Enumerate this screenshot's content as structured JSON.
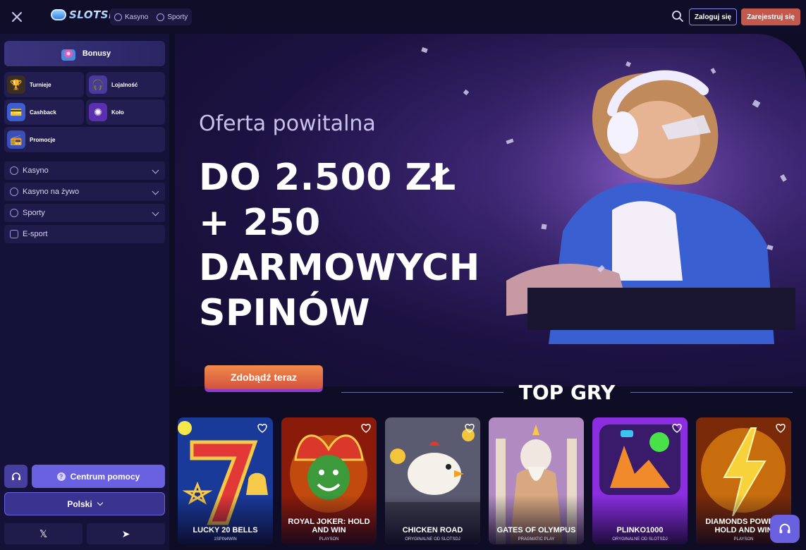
{
  "header": {
    "logo_text": "SLOTSDJ",
    "nav": [
      {
        "label": "Kasyno",
        "icon": "casino-icon"
      },
      {
        "label": "Sporty",
        "icon": "sports-icon"
      }
    ],
    "login_label": "Zaloguj się",
    "register_label": "Zarejestruj się"
  },
  "sidebar": {
    "bonus_label": "Bonusy",
    "tiles": [
      {
        "label": "Turnieje",
        "icon": "trophy-icon"
      },
      {
        "label": "Lojalność",
        "icon": "loyalty-icon"
      },
      {
        "label": "Cashback",
        "icon": "cashback-icon"
      },
      {
        "label": "Koło",
        "icon": "wheel-icon"
      },
      {
        "label": "Promocje",
        "icon": "promo-icon"
      }
    ],
    "menu": [
      {
        "label": "Kasyno",
        "icon": "casino-icon"
      },
      {
        "label": "Kasyno na żywo",
        "icon": "live-casino-icon"
      },
      {
        "label": "Sporty",
        "icon": "sports-icon"
      },
      {
        "label": "E-sport",
        "icon": "esport-icon"
      }
    ],
    "help_label": "Centrum pomocy",
    "language_label": "Polski",
    "social": [
      {
        "label": "𝕏",
        "icon": "x-icon"
      },
      {
        "label": "➤",
        "icon": "telegram-icon"
      }
    ]
  },
  "hero": {
    "subtitle": "Oferta powitalna",
    "title_lines": [
      "DO 2.500 ZŁ",
      "+ 250",
      "DARMOWYCH",
      "SPINÓW"
    ],
    "cta_label": "Zdobądź teraz"
  },
  "top_games": {
    "title": "TOP GRY",
    "games": [
      {
        "name": "LUCKY 20 BELLS",
        "provider": "1SPIN4WIN"
      },
      {
        "name": "ROYAL JOKER: HOLD AND WIN",
        "provider": "PLAYSON"
      },
      {
        "name": "CHICKEN ROAD",
        "provider": "ORYGINALNE OD SLOTSDJ"
      },
      {
        "name": "GATES OF OLYMPUS",
        "provider": "PRAGMATIC PLAY"
      },
      {
        "name": "PLINKO1000",
        "provider": "ORYGINALNE OD SLOTSDJ"
      },
      {
        "name": "DIAMONDS POWER: HOLD AND WIN",
        "provider": "PLAYSON"
      }
    ]
  },
  "colors": {
    "accent": "#6a61e0",
    "register": "#c3584c",
    "cta": "#e6703f"
  }
}
